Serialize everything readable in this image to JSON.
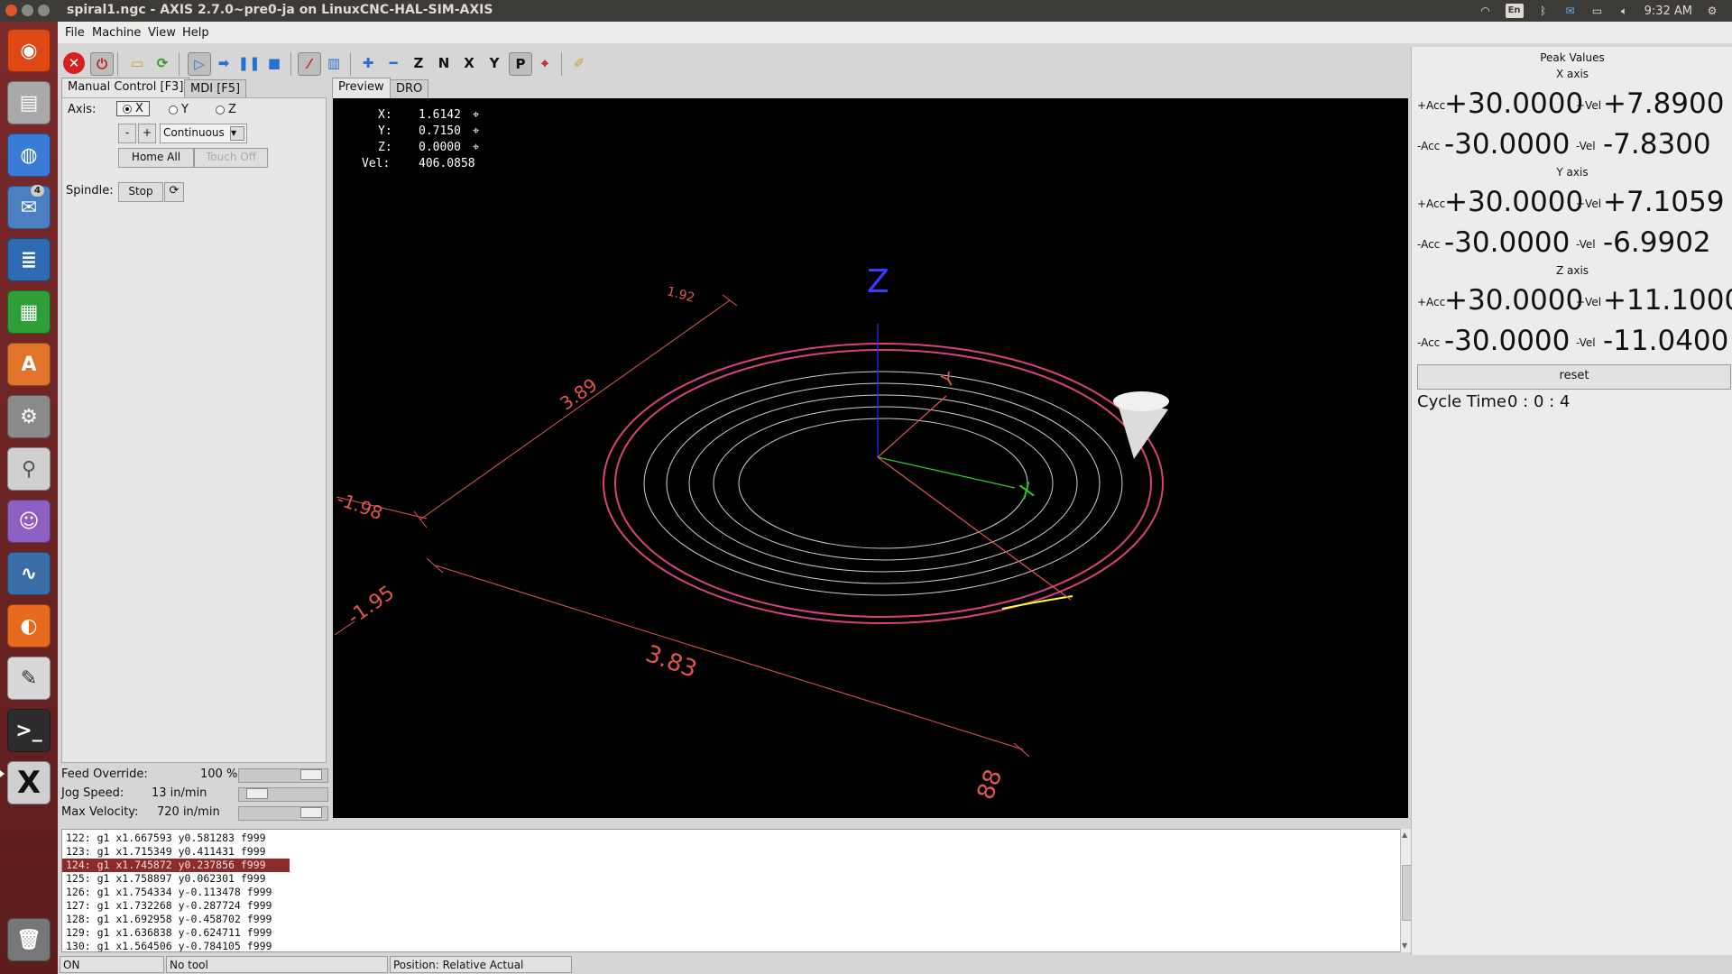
{
  "window": {
    "title": "spiral1.ngc - AXIS 2.7.0~pre0-ja on LinuxCNC-HAL-SIM-AXIS"
  },
  "tray": {
    "lang": "En",
    "clock": "9:32 AM"
  },
  "launcher": {
    "mail_badge": "4"
  },
  "menu": [
    "File",
    "Machine",
    "View",
    "Help"
  ],
  "left_tabs": {
    "manual": "Manual Control [F3]",
    "mdi": "MDI [F5]"
  },
  "manual": {
    "axis_label": "Axis:",
    "axes": [
      "X",
      "Y",
      "Z"
    ],
    "selected_axis": "X",
    "minus": "-",
    "plus": "+",
    "jog_mode": "Continuous",
    "home_all": "Home All",
    "touch_off": "Touch Off",
    "spindle_label": "Spindle:",
    "spindle_stop": "Stop"
  },
  "overrides": {
    "feed_label": "Feed Override:",
    "feed_value": "100 %",
    "jog_label": "Jog Speed:",
    "jog_value": "13 in/min",
    "maxvel_label": "Max Velocity:",
    "maxvel_value": "720 in/min"
  },
  "right_tabs": {
    "preview": "Preview",
    "dro": "DRO"
  },
  "dro": {
    "x_label": "X:",
    "x": "1.6142",
    "y_label": "Y:",
    "y": "0.7150",
    "z_label": "Z:",
    "z": "0.0000",
    "vel_label": "Vel:",
    "vel": "406.0858"
  },
  "preview_labels": {
    "z_axis": "Z",
    "x_axis": "X",
    "y_axis": "Y",
    "dim_top": "1.92",
    "dim_left1": "3.89",
    "dim_left2": "-1.98",
    "dim_left3": "-1.95",
    "dim_bottom": "3.83",
    "dim_corner": "88"
  },
  "code_lines": [
    "122: g1 x1.667593 y0.581283 f999",
    "123: g1 x1.715349 y0.411431 f999",
    "124: g1 x1.745872 y0.237856 f999",
    "125: g1 x1.758897 y0.062301 f999",
    "126: g1 x1.754334 y-0.113478 f999",
    "127: g1 x1.732268 y-0.287724 f999",
    "128: g1 x1.692958 y-0.458702 f999",
    "129: g1 x1.636838 y-0.624711 f999",
    "130: g1 x1.564506 y-0.784105 f999"
  ],
  "highlight_line": "124: g1 x1.745872 y0.237856 f999",
  "status": {
    "machine": "ON",
    "tool": "No tool",
    "position": "Position: Relative Actual"
  },
  "peak": {
    "title": "Peak Values",
    "x_title": "X axis",
    "y_title": "Y axis",
    "z_title": "Z axis",
    "acc_pos": "+Acc",
    "acc_neg": "-Acc",
    "vel_pos": "+Vel",
    "vel_neg": "-Vel",
    "x": {
      "acc_p": "+30.0000",
      "vel_p": "+7.8900",
      "acc_n": "-30.0000",
      "vel_n": "-7.8300"
    },
    "y": {
      "acc_p": "+30.0000",
      "vel_p": "+7.1059",
      "acc_n": "-30.0000",
      "vel_n": "-6.9902"
    },
    "z": {
      "acc_p": "+30.0000",
      "vel_p": "+11.1000",
      "acc_n": "-30.0000",
      "vel_n": "-11.0400"
    },
    "reset": "reset",
    "cycle_label": "Cycle Time",
    "cycle_value": "0 : 0 : 4"
  },
  "colors": {
    "toolpath": "#d8407e",
    "dims": "#e0564f",
    "z_axis": "#2b2bff",
    "x_axis": "#2ecc2e",
    "launcher": "#6b2424"
  },
  "icons": [
    "estop-icon",
    "power-icon",
    "open-file-icon",
    "reload-icon",
    "run-icon",
    "step-icon",
    "pause-icon",
    "stop-icon",
    "toggle-view-icon",
    "zoom-in-icon",
    "zoom-out-icon",
    "view-z-icon",
    "view-x-icon",
    "view-y-icon",
    "view-p-icon",
    "clear-icon"
  ]
}
